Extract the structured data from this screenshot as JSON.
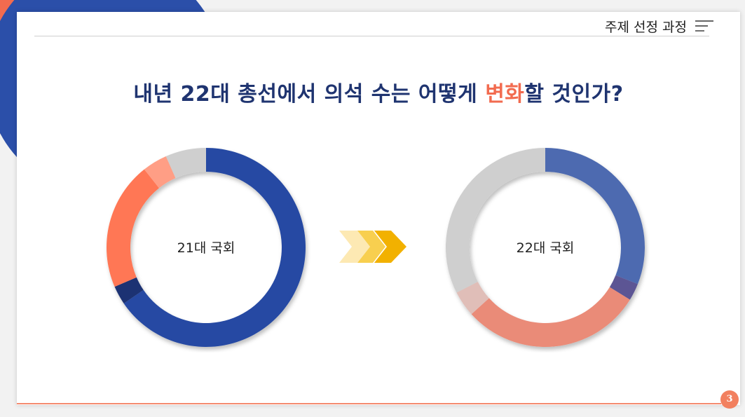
{
  "header": {
    "section_title": "주제 선정 과정",
    "menu_icon": "menu-lines-icon"
  },
  "headline": {
    "prefix": "내년 22대 총선에서 의석 수는 어떻게 ",
    "highlight": "변화",
    "suffix": "할 것인가?"
  },
  "charts": {
    "left": {
      "label": "21대 국회"
    },
    "right": {
      "label": "22대 국회"
    }
  },
  "transition_icon": "chevron-arrows-icon",
  "page_number": "3",
  "colors": {
    "navy": "#264aa3",
    "dark_navy": "#1d3373",
    "coral": "#ff7755",
    "light_coral": "#ff9e85",
    "gray": "#cfcfcf",
    "accent": "#f26b4f"
  },
  "chart_data": [
    {
      "type": "pie",
      "title": "21대 국회",
      "segments": [
        {
          "value": 64.5,
          "color": "#264aa3"
        },
        {
          "value": 3.0,
          "color": "#1d3373"
        },
        {
          "value": 20.5,
          "color": "#ff7755"
        },
        {
          "value": 4.0,
          "color": "#ff9e85"
        },
        {
          "value": 6.5,
          "color": "#cfcfcf"
        }
      ]
    },
    {
      "type": "pie",
      "title": "22대 국회",
      "segments": [
        {
          "value": 31.0,
          "color": "#4e6bb0"
        },
        {
          "value": 2.8,
          "color": "#5c5594"
        },
        {
          "value": 29.5,
          "color": "#ea8b78"
        },
        {
          "value": 4.2,
          "color": "#e0beb8"
        },
        {
          "value": 32.5,
          "color": "#cfcfcf"
        }
      ]
    }
  ]
}
